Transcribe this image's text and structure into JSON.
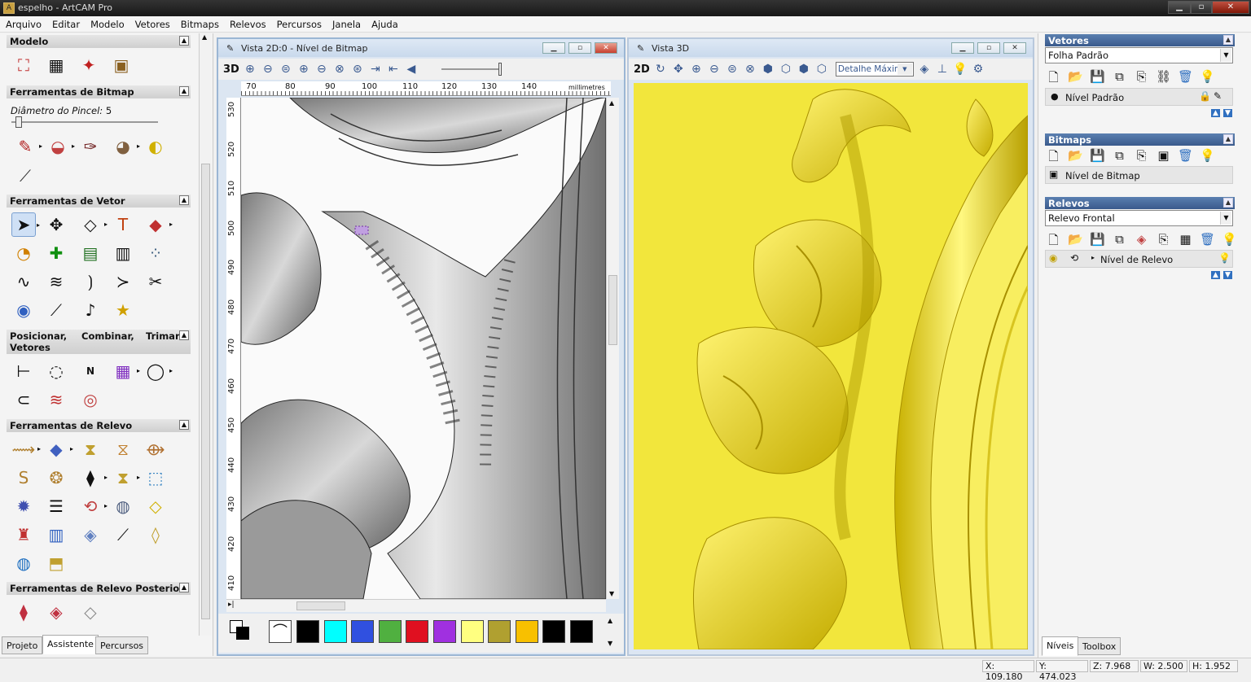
{
  "app": {
    "title": "espelho - ArtCAM Pro",
    "icon": "artcam-icon"
  },
  "window_controls": {
    "minimize": "▁",
    "maximize": "▫",
    "close": "✕"
  },
  "menu": [
    "Arquivo",
    "Editar",
    "Modelo",
    "Vetores",
    "Bitmaps",
    "Relevos",
    "Percursos",
    "Janela",
    "Ajuda"
  ],
  "left": {
    "modelo": {
      "title": "Modelo"
    },
    "bitmap": {
      "title": "Ferramentas de Bitmap",
      "brush_label": "Diâmetro do Pincel:",
      "brush_value": "5",
      "brush_fraction": 0.05
    },
    "vetor": {
      "title": "Ferramentas de Vetor"
    },
    "posicionar": {
      "title_a": "Posicionar,",
      "title_b": "Combinar,",
      "title_c": "Trimar",
      "title_d": "Vetores"
    },
    "relevo": {
      "title": "Ferramentas de Relevo"
    },
    "relevo_posterior": {
      "title": "Ferramentas de Relevo Posterior"
    },
    "tabs": [
      "Projeto",
      "Assistente",
      "Percursos"
    ]
  },
  "view2d": {
    "title": "Vista 2D:0 - Nível de Bitmap",
    "mode_button": "3D",
    "ruler_units": "millimetres",
    "ruler_x": [
      "70",
      "80",
      "90",
      "100",
      "110",
      "120",
      "130",
      "140"
    ],
    "ruler_y": [
      "530",
      "520",
      "510",
      "500",
      "490",
      "480",
      "470",
      "460",
      "450",
      "440",
      "430",
      "420",
      "410"
    ],
    "palette": [
      "#000000",
      "#00ffff",
      "#3050e0",
      "#50b040",
      "#e01020",
      "#a030e0",
      "#ffff80",
      "#b0a030",
      "#f8c000",
      "#000000",
      "#000000"
    ]
  },
  "view3d": {
    "title": "Vista 3D",
    "mode_button": "2D",
    "detail": "Detalhe Máximo"
  },
  "right": {
    "vetores": {
      "title": "Vetores",
      "combo": "Folha Padrão",
      "layer": "Nível Padrão"
    },
    "bitmaps": {
      "title": "Bitmaps",
      "layer": "Nível de Bitmap"
    },
    "relevos": {
      "title": "Relevos",
      "combo": "Relevo Frontal",
      "layer": "Nível de Relevo"
    },
    "tabs": [
      "Níveis",
      "Toolbox"
    ]
  },
  "status": {
    "x": "X: 109.180",
    "y": "Y: 474.023",
    "z": "Z: 7.968",
    "w": "W: 2.500",
    "h": "H: 1.952"
  }
}
